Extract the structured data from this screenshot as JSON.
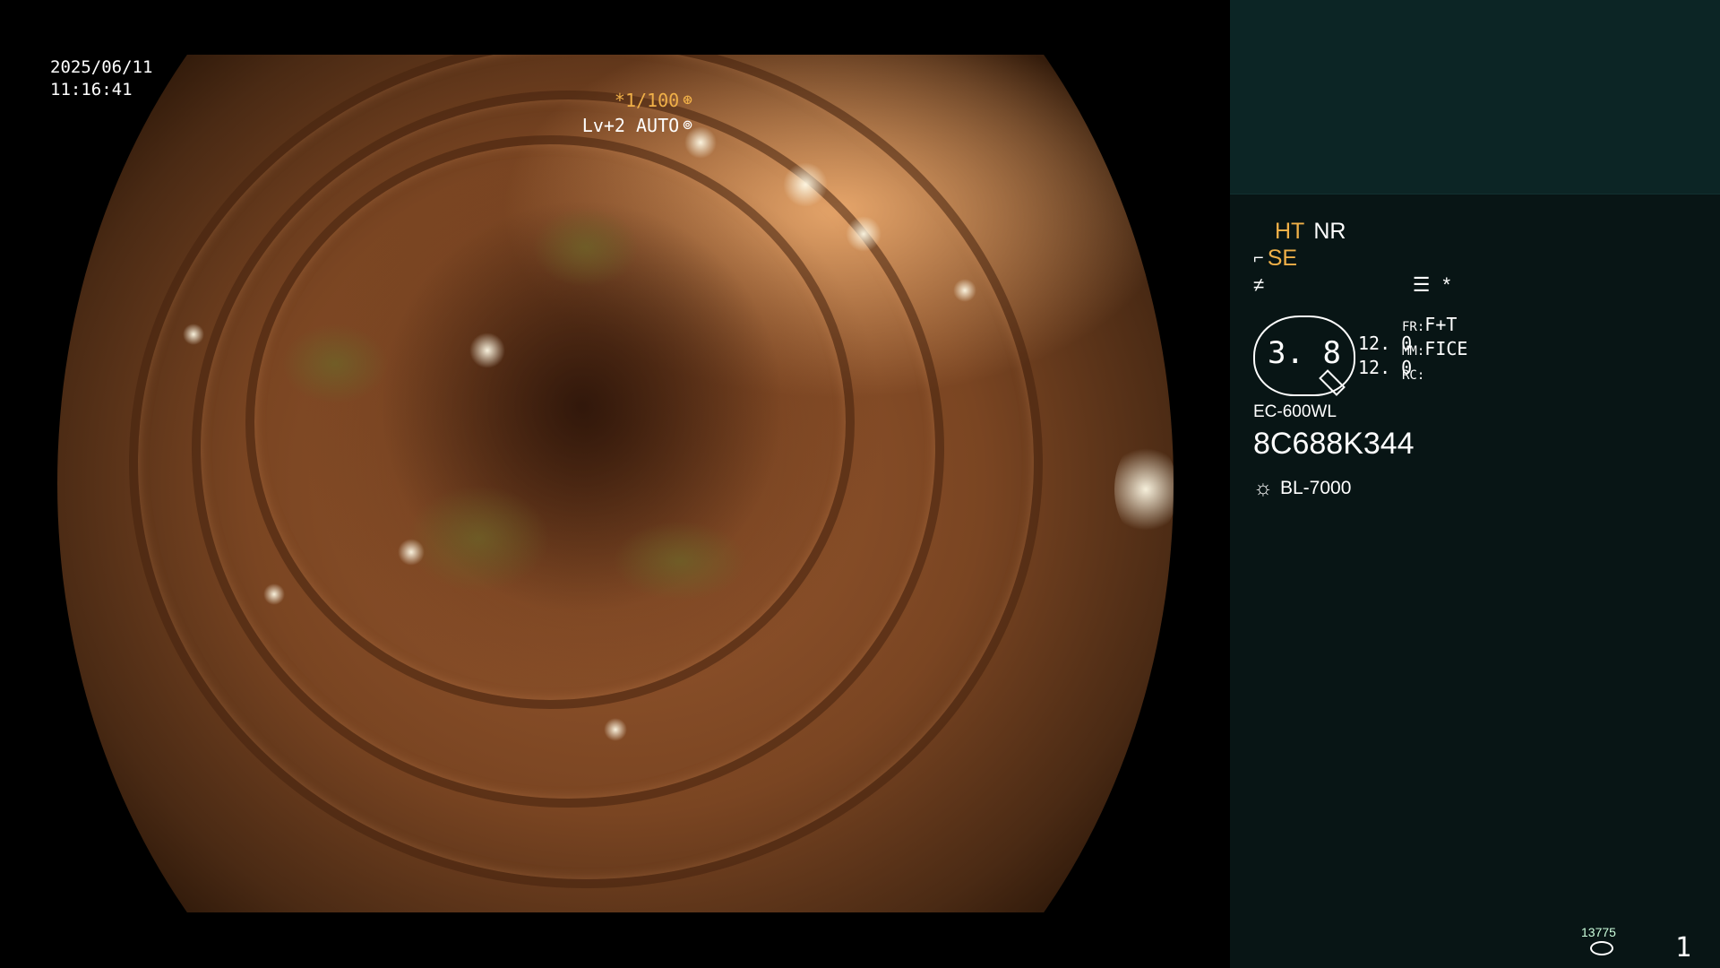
{
  "video_overlay": {
    "date": "2025/06/11",
    "time": "11:16:41",
    "shutter": "*1/100",
    "level": "Lv+2 AUTO",
    "shutter_icon": "aperture-icon",
    "level_icon": "auto-iris-icon"
  },
  "side_panel": {
    "ht_label": "HT",
    "nr_label": "NR",
    "se_label": "SE",
    "se_icon": "enhance-icon",
    "edge_icon": "edge-icon",
    "menu_icon": "menu-list-icon",
    "star_label": "*",
    "iris_value": "3. 8",
    "val_1": "12. 0",
    "val_2": "12. 0",
    "fr_key": "FR:",
    "fr_value": "F+T",
    "mm_key": "MM:",
    "mm_value": "FICE",
    "rc_key": "RC:",
    "rc_value": "",
    "scope_model": "EC-600WL",
    "scope_serial": "8C688K344",
    "light_source": "BL-7000",
    "light_icon": "sun-icon",
    "counter": "13775",
    "storage_icon": "disk-icon",
    "page_number": "1"
  },
  "colors": {
    "accent": "#f0b048",
    "panel_bg": "#081515",
    "panel_top_bg": "#0c2525"
  }
}
